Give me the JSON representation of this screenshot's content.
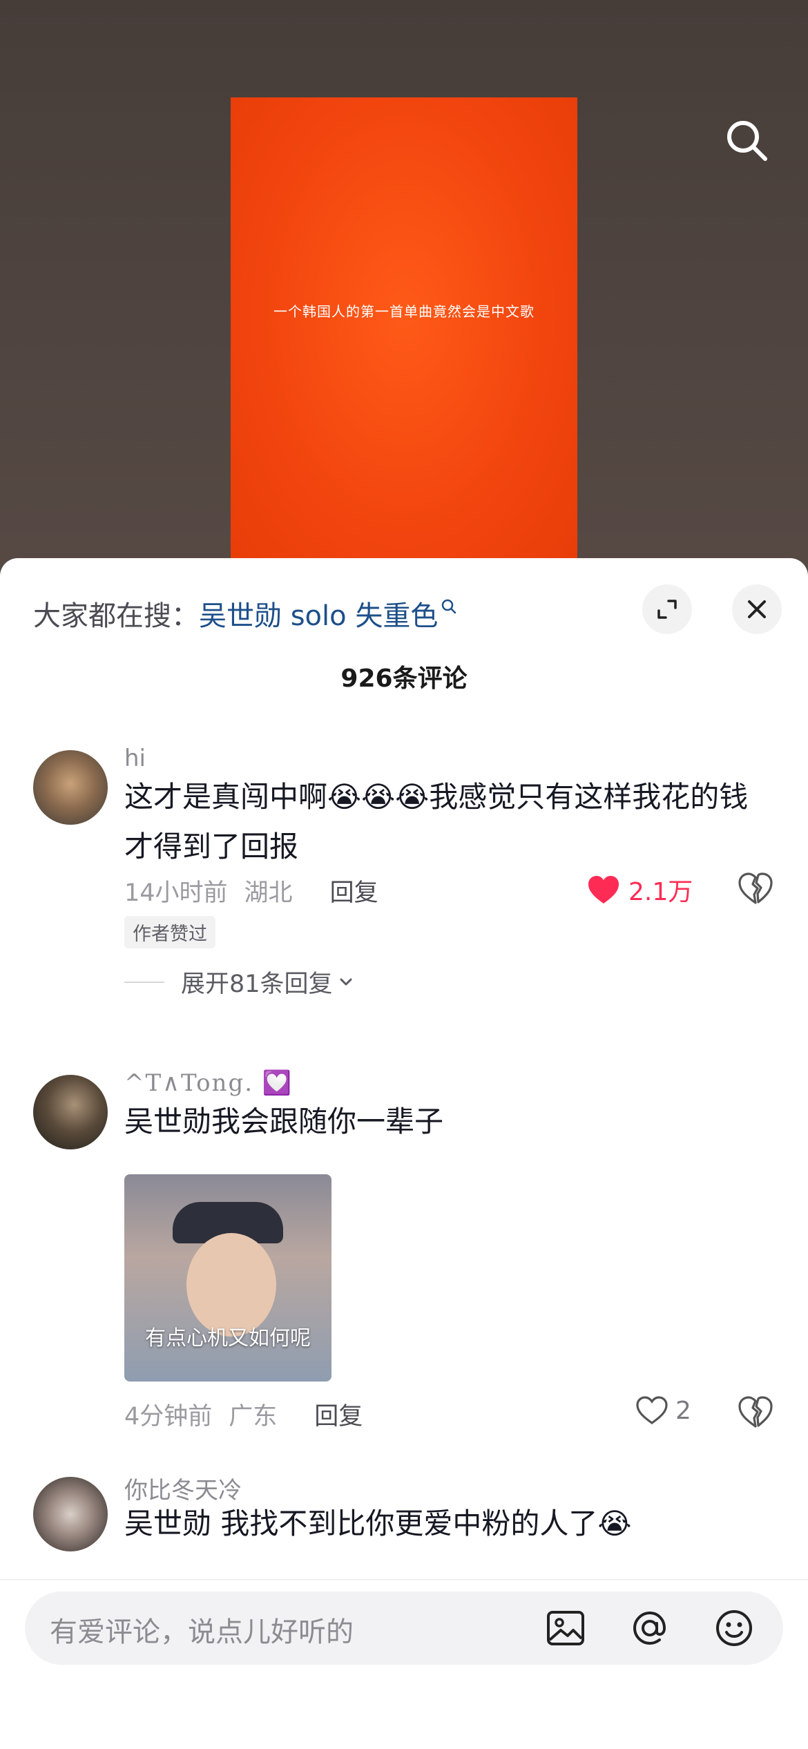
{
  "video": {
    "caption": "一个韩国人的第一首单曲竟然会是中文歌",
    "background_color": "#f1470f"
  },
  "sheet": {
    "hot_search_prefix": "大家都在搜：",
    "hot_search_term": "吴世勋 solo 失重色",
    "comment_count_title": "926条评论"
  },
  "comments": [
    {
      "username": "hi",
      "text": "这才是真闯中啊😭😭😭我感觉只有这样我花的钱才得到了回报",
      "time": "14小时前",
      "location": "湖北",
      "reply_label": "回复",
      "likes": "2.1万",
      "liked": true,
      "author_tag": "作者赞过",
      "expand_label": "展开81条回复"
    },
    {
      "username": "^T∧Tong.",
      "username_badge": "💟",
      "text": "吴世勋我会跟随你一辈子",
      "sticker_caption": "有点心机又如何呢",
      "time": "4分钟前",
      "location": "广东",
      "reply_label": "回复",
      "likes": "2",
      "liked": false
    },
    {
      "username": "你比冬天冷",
      "text": "吴世勋 我找不到比你更爱中粉的人了😭"
    }
  ],
  "input_bar": {
    "placeholder": "有爱评论，说点儿好听的"
  },
  "icons": {
    "search": "search-icon",
    "expand": "expand-icon",
    "close": "close-icon",
    "heart": "heart-icon",
    "dislike": "broken-heart-icon",
    "image": "image-icon",
    "mention": "at-icon",
    "emoji": "emoji-icon"
  },
  "colors": {
    "like_red": "#fe2c55",
    "link_blue": "#1d4f8a"
  }
}
